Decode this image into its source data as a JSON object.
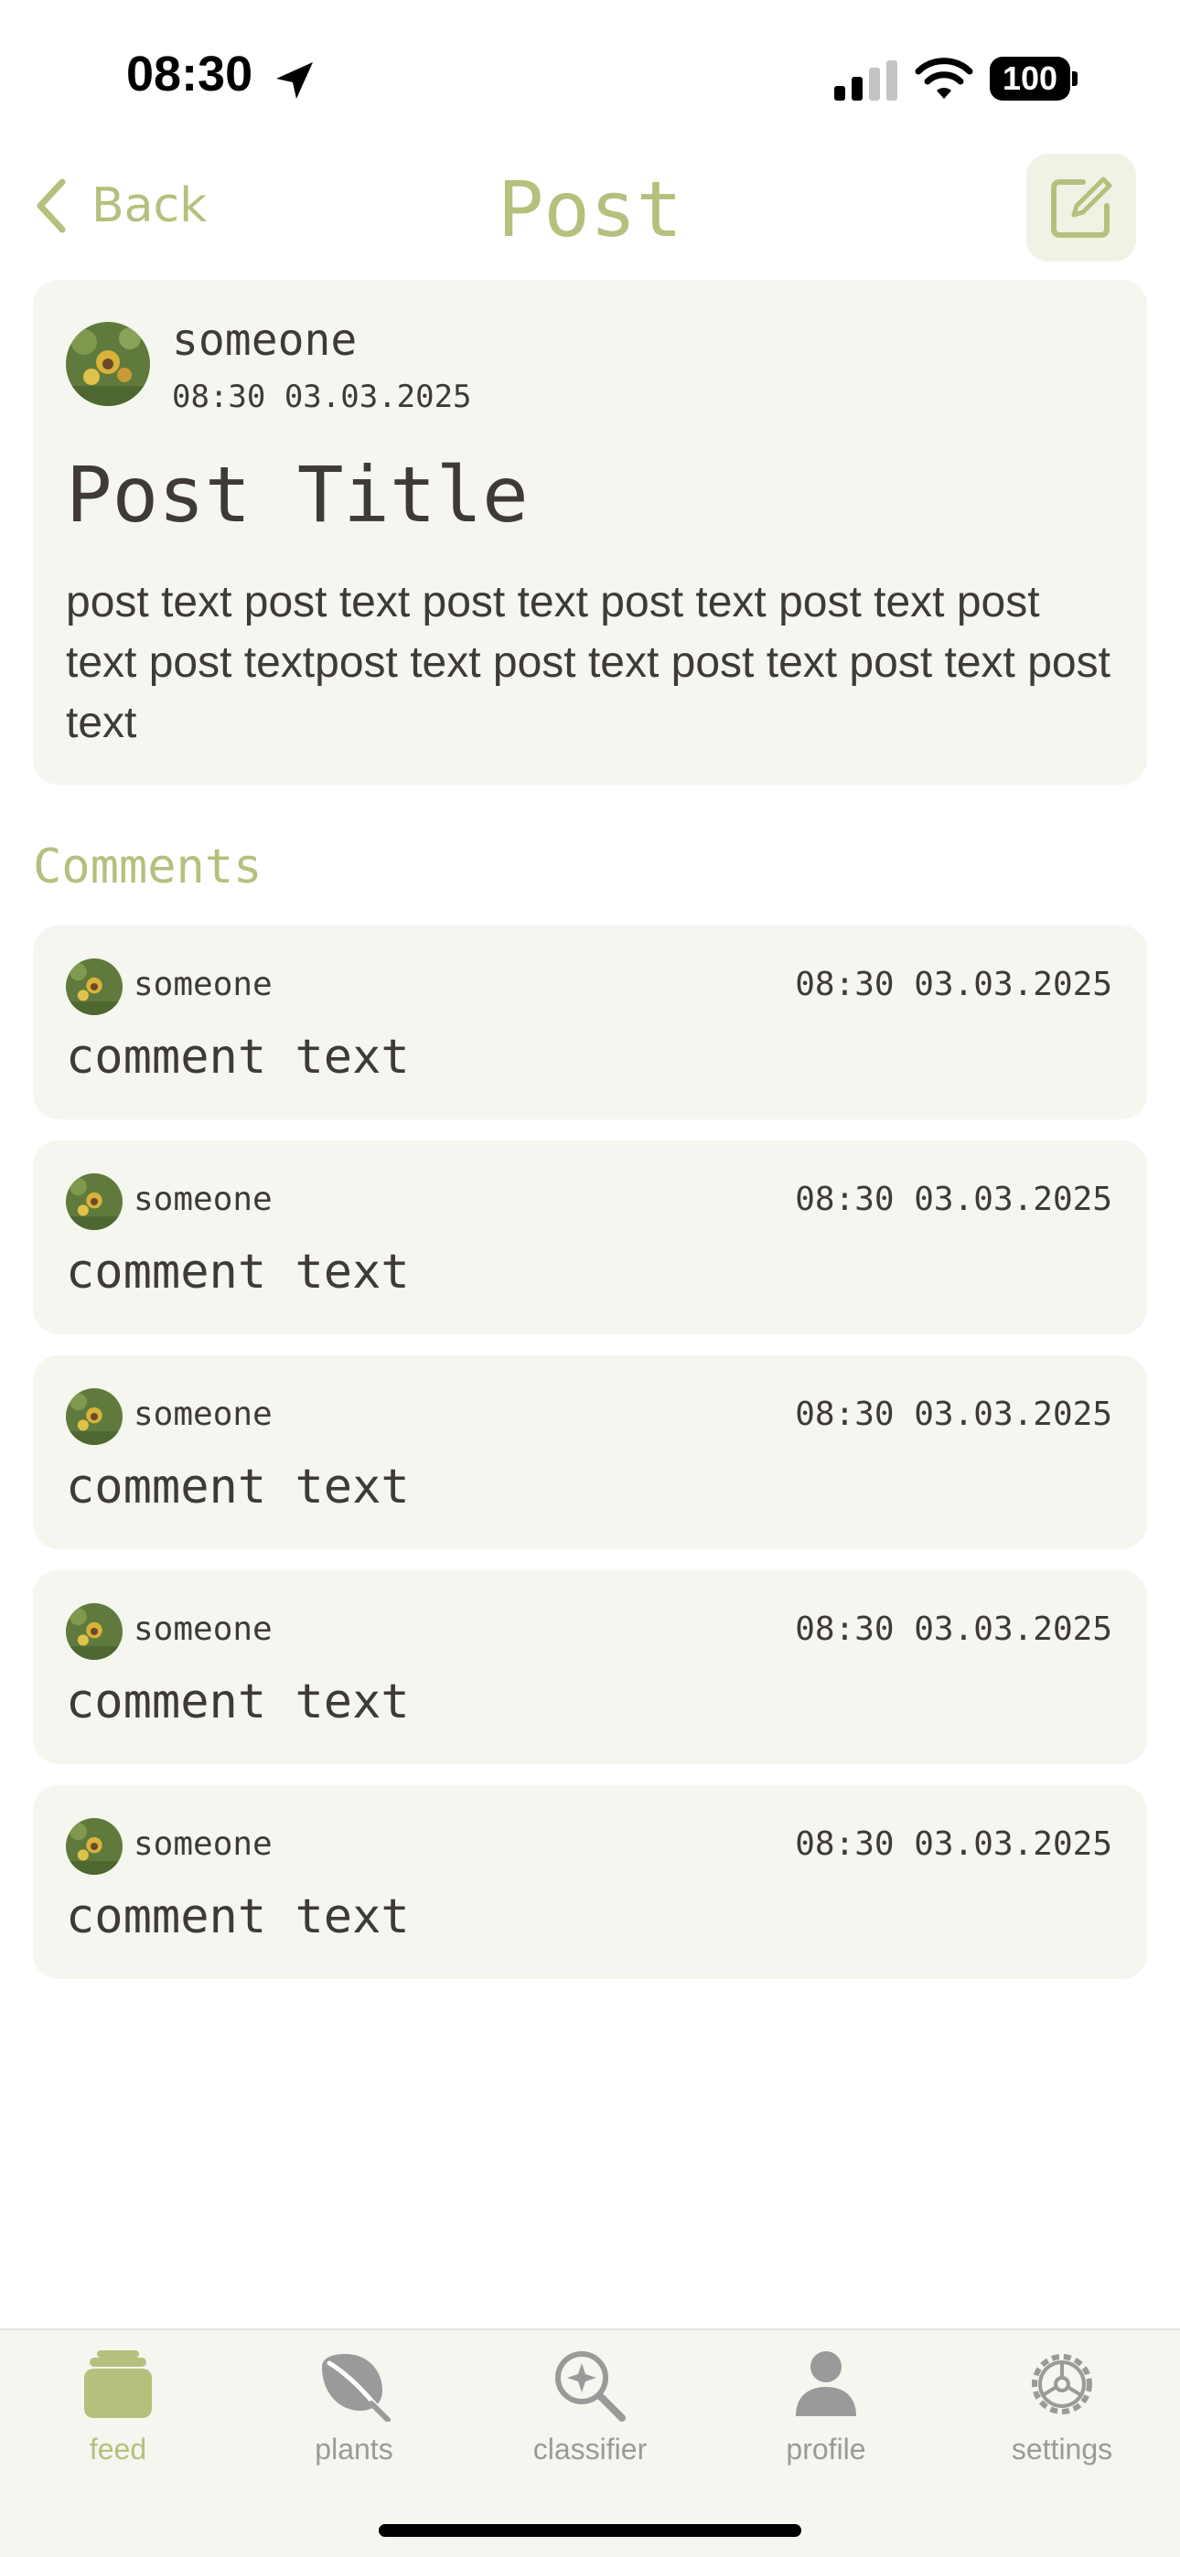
{
  "status_bar": {
    "time": "08:30",
    "battery": "100",
    "icons": [
      "location-arrow-icon",
      "cellular-signal-icon",
      "wifi-icon",
      "battery-icon"
    ]
  },
  "nav": {
    "back_label": "Back",
    "title": "Post",
    "edit_icon": "compose-icon"
  },
  "post": {
    "author": "someone",
    "timestamp": "08:30 03.03.2025",
    "title": "Post Title",
    "body": "post text post text post text post text post text post text post textpost text post text post text post text post text"
  },
  "comments_heading": "Comments",
  "comments": [
    {
      "author": "someone",
      "timestamp": "08:30 03.03.2025",
      "text": "comment text"
    },
    {
      "author": "someone",
      "timestamp": "08:30 03.03.2025",
      "text": "comment text"
    },
    {
      "author": "someone",
      "timestamp": "08:30 03.03.2025",
      "text": "comment text"
    },
    {
      "author": "someone",
      "timestamp": "08:30 03.03.2025",
      "text": "comment text"
    },
    {
      "author": "someone",
      "timestamp": "08:30 03.03.2025",
      "text": "comment text"
    }
  ],
  "tab_bar": {
    "active": "feed",
    "tabs": [
      {
        "label": "feed",
        "icon": "feed-stack-icon"
      },
      {
        "label": "plants",
        "icon": "leaf-icon"
      },
      {
        "label": "classifier",
        "icon": "magnifier-sparkle-icon"
      },
      {
        "label": "profile",
        "icon": "person-icon"
      },
      {
        "label": "settings",
        "icon": "gear-icon"
      }
    ]
  },
  "colors": {
    "accent": "#b5c07d",
    "card_background": "#f4f6ef",
    "text": "#3f3a36",
    "tab_inactive": "#9a9a9a"
  }
}
